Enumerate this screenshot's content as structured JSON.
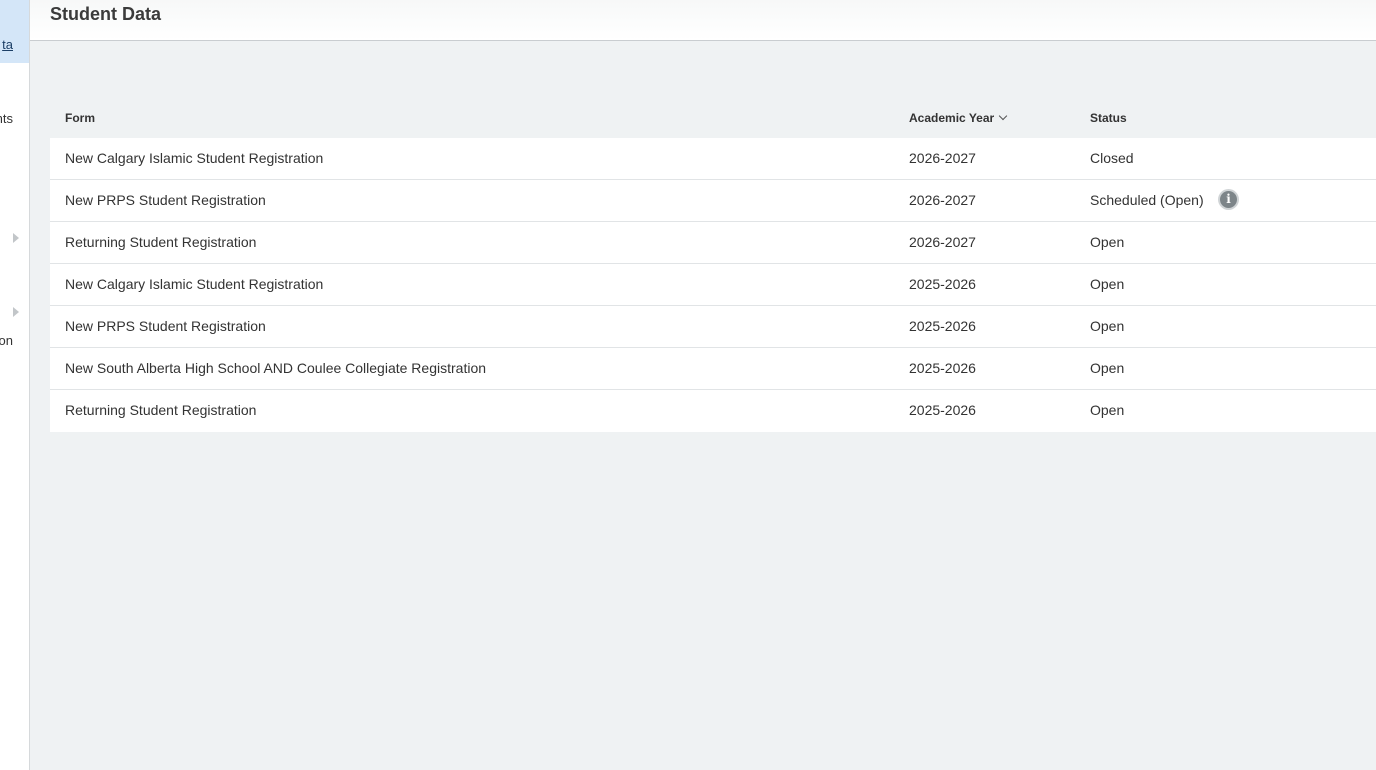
{
  "sidebar": {
    "items": [
      {
        "label": "ta",
        "active": true,
        "has_arrow": false
      },
      {
        "label": "nts",
        "active": false,
        "has_arrow": false
      },
      {
        "label": "",
        "active": false,
        "has_arrow": true
      },
      {
        "label": "",
        "active": false,
        "has_arrow": true
      },
      {
        "label": "on",
        "active": false,
        "has_arrow": false
      }
    ]
  },
  "header": {
    "title": "Student Data"
  },
  "table": {
    "columns": {
      "form": "Form",
      "year": "Academic Year",
      "status": "Status"
    },
    "sort_icon": "chevron-down-icon",
    "rows": [
      {
        "form": "New Calgary Islamic Student Registration",
        "year": "2026-2027",
        "status": "Closed",
        "info": false
      },
      {
        "form": "New PRPS Student Registration",
        "year": "2026-2027",
        "status": "Scheduled (Open)",
        "info": true
      },
      {
        "form": "Returning Student Registration",
        "year": "2026-2027",
        "status": "Open",
        "info": false
      },
      {
        "form": "New Calgary Islamic Student Registration",
        "year": "2025-2026",
        "status": "Open",
        "info": false
      },
      {
        "form": "New PRPS Student Registration",
        "year": "2025-2026",
        "status": "Open",
        "info": false
      },
      {
        "form": "New South Alberta High School AND Coulee Collegiate Registration",
        "year": "2025-2026",
        "status": "Open",
        "info": false
      },
      {
        "form": "Returning Student Registration",
        "year": "2025-2026",
        "status": "Open",
        "info": false
      }
    ]
  },
  "info_icon_glyph": "i",
  "colors": {
    "background": "#eff2f3",
    "active_nav": "#d4e6f8",
    "info_icon": "#7d8589"
  }
}
